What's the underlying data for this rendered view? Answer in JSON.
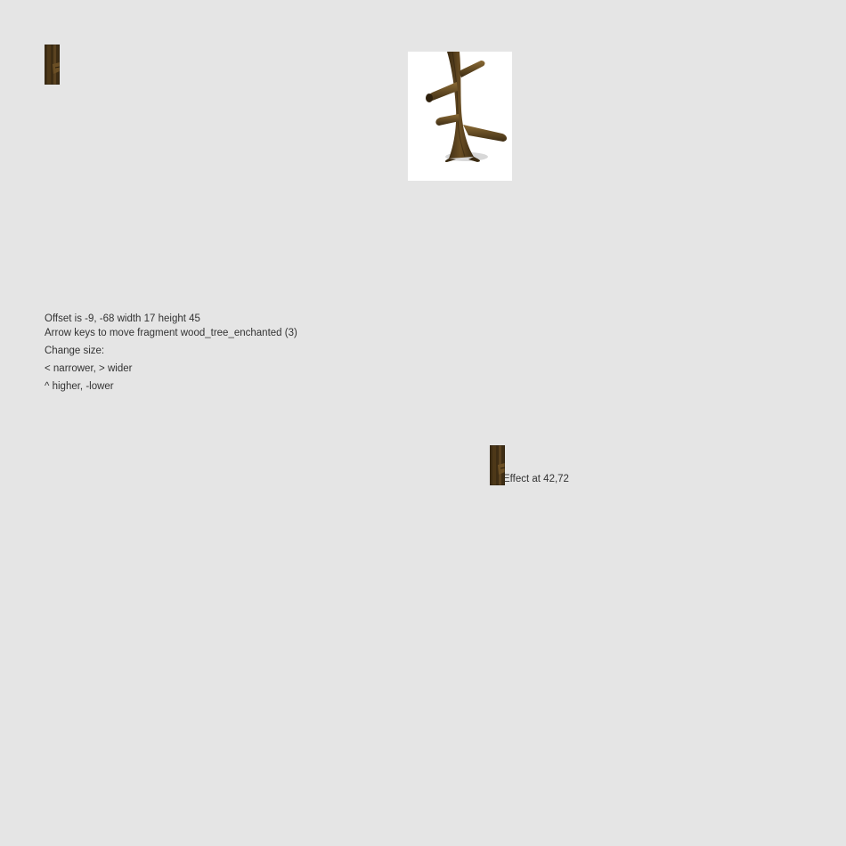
{
  "editor": {
    "offset_text": "Offset is -9, -68 width 17 height 45",
    "instructions": "Arrow keys to move fragment wood_tree_enchanted (3)",
    "change_size_label": "Change size:",
    "width_keys": "< narrower, > wider",
    "height_keys": "^ higher, -lower"
  },
  "effect": {
    "text": "Effect at 42,72"
  },
  "sprite": {
    "name": "wood_tree_enchanted",
    "fragment_icon": "tree-trunk-fragment-icon",
    "preview_icon": "enchanted-tree-icon"
  },
  "colors": {
    "background": "#e5e5e5",
    "preview_background": "#ffffff",
    "text": "#333333",
    "bark_dark": "#3e2d14",
    "bark_mid": "#5a4220",
    "bark_light": "#7a5c2c"
  }
}
